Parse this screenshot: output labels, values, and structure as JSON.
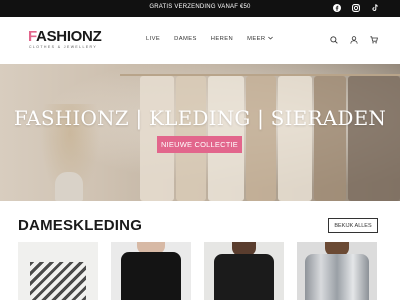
{
  "topbar": {
    "promo": "GRATIS VERZENDING VANAF €50",
    "socials": [
      "facebook-icon",
      "instagram-icon",
      "tiktok-icon"
    ]
  },
  "header": {
    "logo_main_first": "F",
    "logo_main_rest": "ASHIONZ",
    "logo_sub": "CLOTHES & JEWELLERY",
    "nav": [
      {
        "label": "LIVE"
      },
      {
        "label": "DAMES"
      },
      {
        "label": "HEREN"
      },
      {
        "label": "MEER"
      }
    ],
    "icons": [
      "search-icon",
      "account-icon",
      "cart-icon"
    ]
  },
  "hero": {
    "title": "FASHIONZ | KLEDING | SIERADEN",
    "button": "NIEUWE COLLECTIE"
  },
  "section": {
    "title": "DAMESKLEDING",
    "view_all": "BEKIJK ALLES"
  },
  "colors": {
    "accent": "#e2668c",
    "topbar": "#111111"
  }
}
